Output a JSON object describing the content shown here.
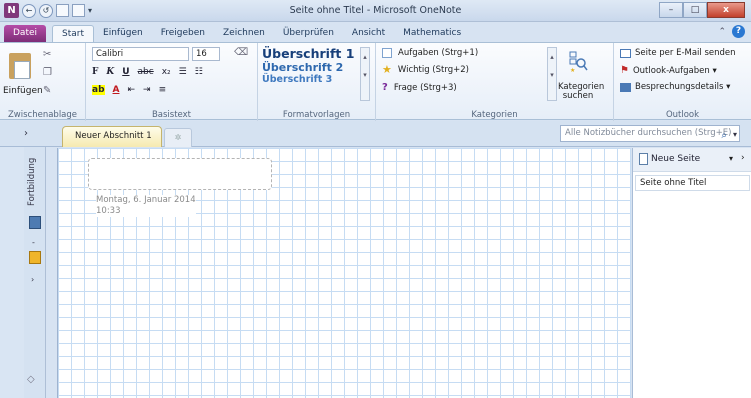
{
  "window": {
    "title": "Seite ohne Titel - Microsoft OneNote",
    "app_icon": "N",
    "minimize": "–",
    "maximize": "□",
    "close": "x"
  },
  "quick_access": {
    "back": "←",
    "forward": "↺",
    "dropdown": "▾"
  },
  "ribbon_tabs": [
    {
      "label": "Datei"
    },
    {
      "label": "Start"
    },
    {
      "label": "Einfügen"
    },
    {
      "label": "Freigeben"
    },
    {
      "label": "Zeichnen"
    },
    {
      "label": "Überprüfen"
    },
    {
      "label": "Ansicht"
    },
    {
      "label": "Mathematics"
    }
  ],
  "ribbon_help": {
    "collapse": "⌃",
    "help": "?"
  },
  "clipboard": {
    "paste_label": "Einfügen",
    "group_label": "Zwischenablage"
  },
  "basic_text": {
    "font": "Calibri",
    "size": "16",
    "bold": "F",
    "italic": "K",
    "underline": "U",
    "strike": "abc",
    "subscript": "x₂",
    "highlight": "ab",
    "fontcolor": "A",
    "group_label": "Basistext"
  },
  "styles": {
    "h1": "Überschrift 1",
    "h2": "Überschrift 2",
    "h3": "Überschrift 3",
    "group_label": "Formatvorlagen"
  },
  "tags": {
    "items": [
      {
        "label": "Aufgaben (Strg+1)"
      },
      {
        "label": "Wichtig (Strg+2)"
      },
      {
        "label": "Frage (Strg+3)"
      }
    ],
    "search_label_1": "Kategorien",
    "search_label_2": "suchen",
    "group_label": "Kategorien"
  },
  "outlook": {
    "items": [
      {
        "label": "Seite per E-Mail senden"
      },
      {
        "label": "Outlook-Aufgaben ▾"
      },
      {
        "label": "Besprechungsdetails ▾"
      }
    ],
    "group_label": "Outlook"
  },
  "sections": {
    "collapse": "›",
    "active_tab": "Neuer Abschnitt 1",
    "add_tab": "✲",
    "search_placeholder": "Alle Notizbücher durchsuchen (Strg+E)",
    "search_icon": "⌕",
    "search_dropdown": "▾"
  },
  "notebook_nav": {
    "label": "Fortbildung",
    "dash": "-",
    "arrow": "›",
    "bottom": "◇"
  },
  "page": {
    "date": "Montag, 6. Januar 2014",
    "time": "10:33"
  },
  "page_list": {
    "new_page": "Neue Seite",
    "dropdown": "▾",
    "next": "›",
    "entries": [
      {
        "label": "Seite ohne Titel"
      }
    ]
  }
}
